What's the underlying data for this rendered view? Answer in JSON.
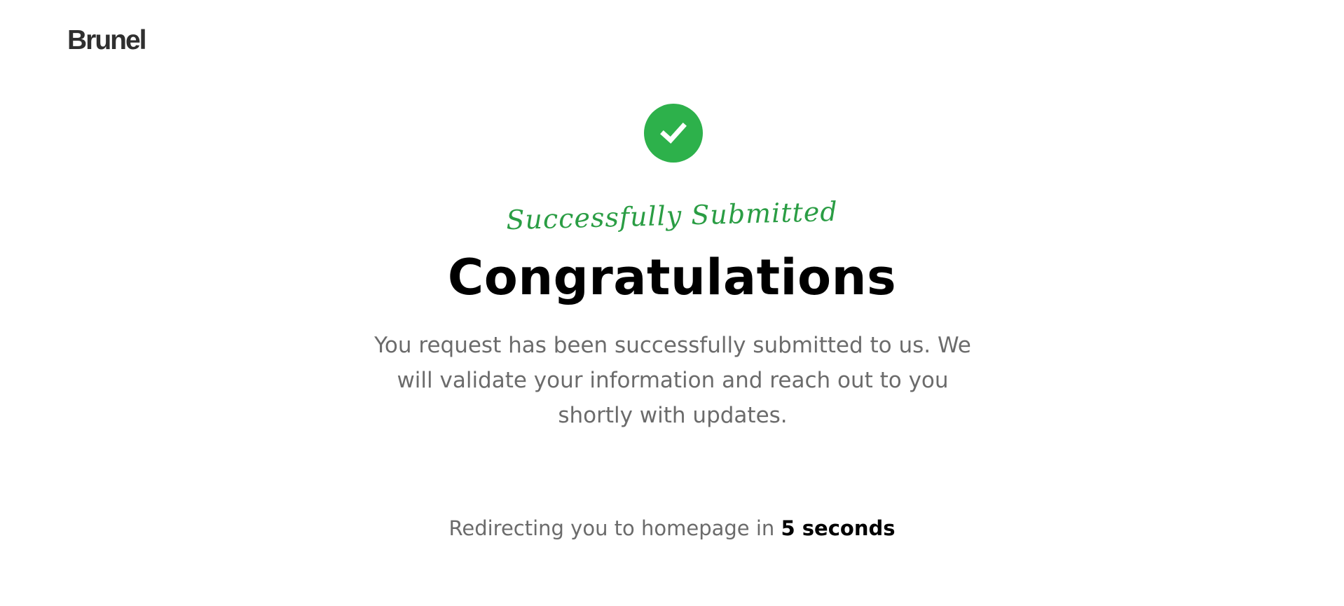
{
  "header": {
    "logo_text": "Brunel"
  },
  "status": {
    "icon": "check-circle-icon",
    "icon_color": "#2db14b",
    "kicker": "Successfully Submitted",
    "kicker_color": "#2a9d44",
    "title": "Congratulations",
    "message": "You request has been successfully submitted to us. We will validate your information and reach out to you shortly with updates."
  },
  "redirect": {
    "prefix": "Redirecting you to homepage in ",
    "countdown": "5 seconds"
  }
}
